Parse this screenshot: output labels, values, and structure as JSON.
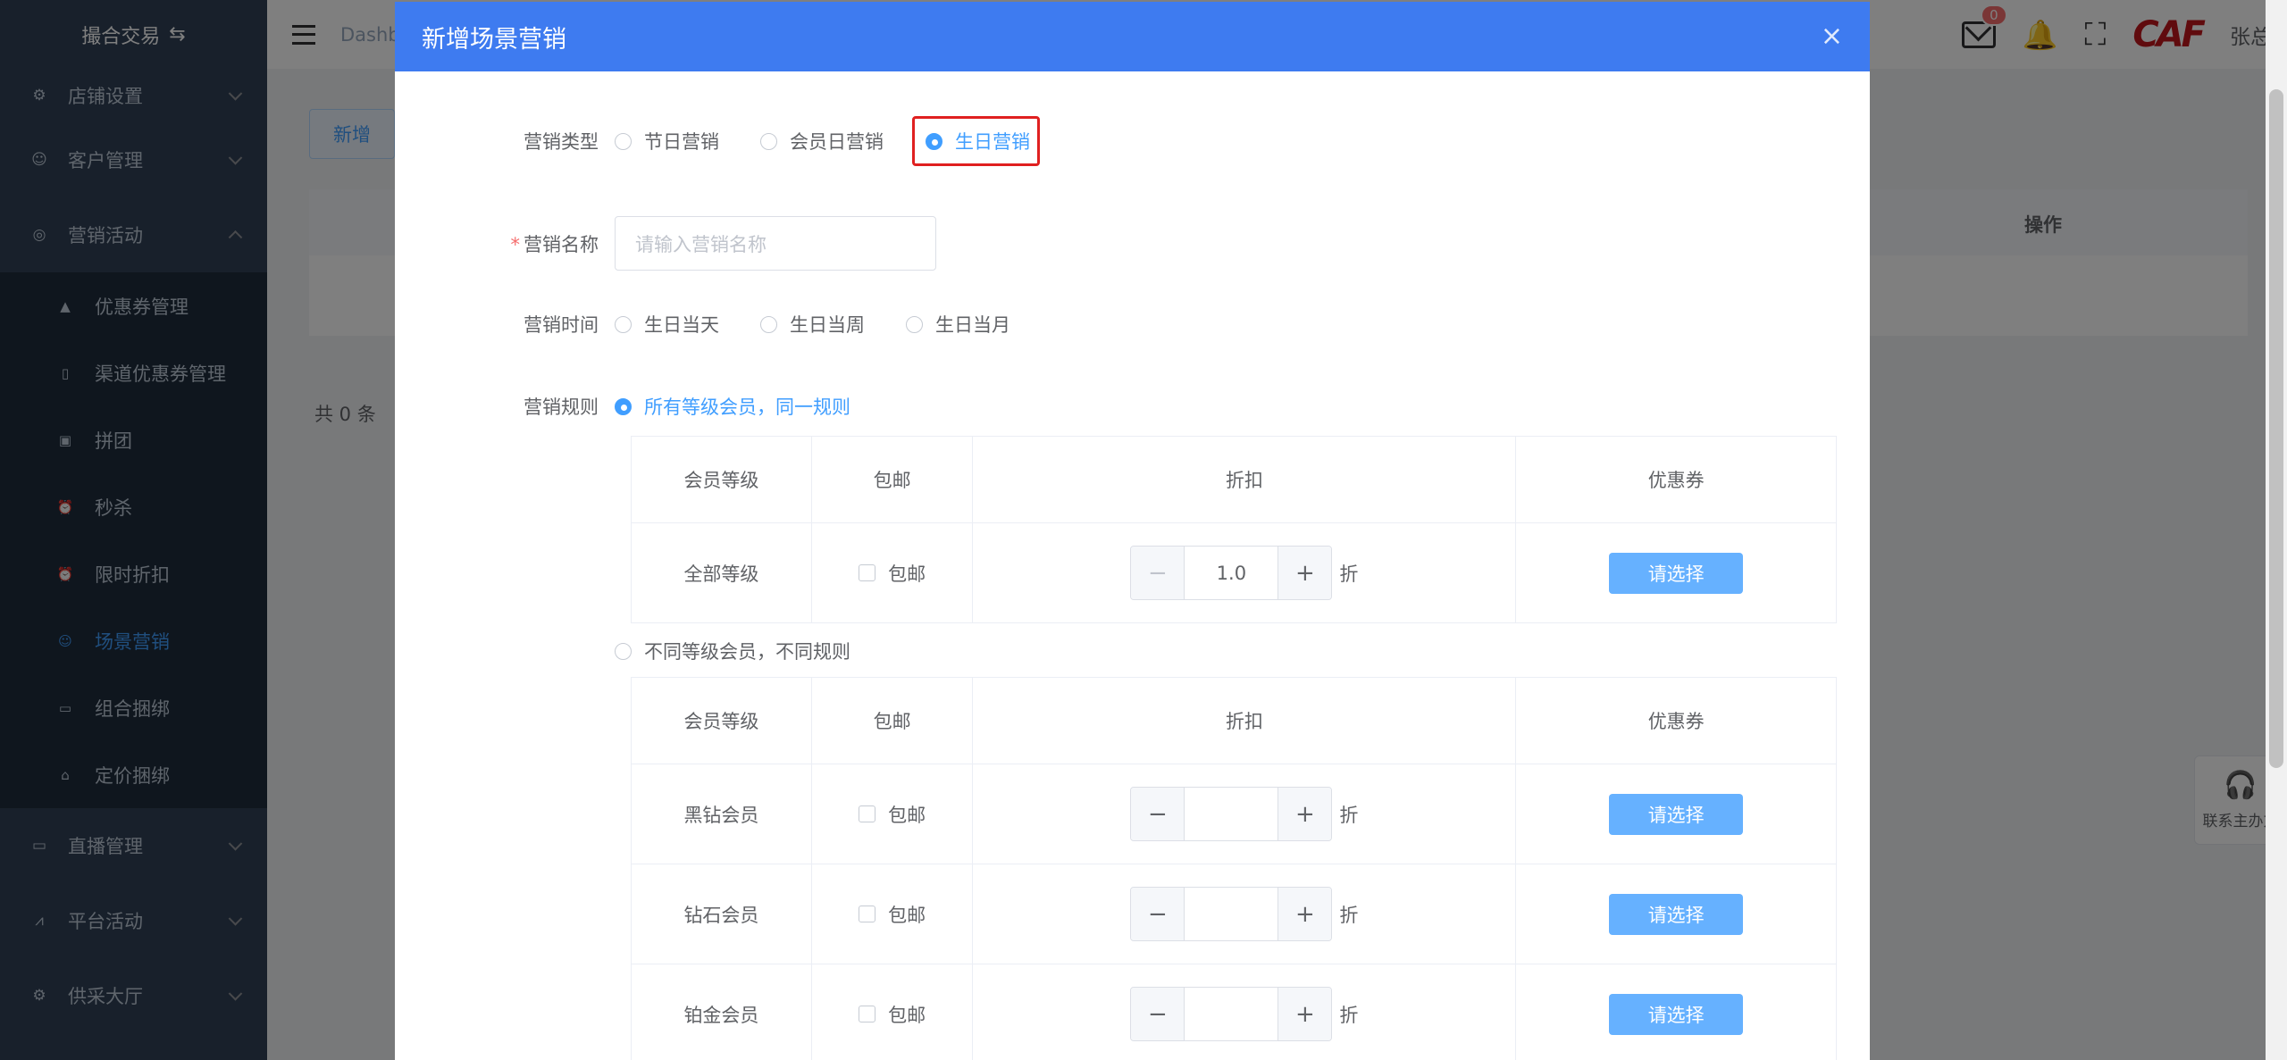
{
  "sidebar": {
    "brand": "撮合交易",
    "menu_top": [
      {
        "label": "店铺设置",
        "icon": "gear-icon"
      },
      {
        "label": "客户管理",
        "icon": "user-icon"
      },
      {
        "label": "营销活动",
        "icon": "compass-icon"
      }
    ],
    "submenu": [
      {
        "label": "优惠券管理",
        "icon": "lock-icon"
      },
      {
        "label": "渠道优惠券管理",
        "icon": "phone-icon"
      },
      {
        "label": "拼团",
        "icon": "briefcase-icon"
      },
      {
        "label": "秒杀",
        "icon": "alarm-icon"
      },
      {
        "label": "限时折扣",
        "icon": "alarm-icon"
      },
      {
        "label": "场景营销",
        "icon": "smile-icon"
      },
      {
        "label": "组合捆绑",
        "icon": "suitcase-icon"
      },
      {
        "label": "定价捆绑",
        "icon": "basket-icon"
      }
    ],
    "menu_bottom": [
      {
        "label": "直播管理",
        "icon": "video-icon"
      },
      {
        "label": "平台活动",
        "icon": "chart-icon"
      },
      {
        "label": "供采大厅",
        "icon": "gear-icon"
      }
    ]
  },
  "navbar": {
    "breadcrumb": "Dashb",
    "badge_count": "0",
    "logo": "CAF",
    "username": "张总"
  },
  "background": {
    "add_button": "新增",
    "table_op_header": "操作",
    "total": "共 0 条",
    "contact": "联系主办方"
  },
  "dialog": {
    "title": "新增场景营销",
    "type": {
      "label": "营销类型",
      "options": [
        "节日营销",
        "会员日营销",
        "生日营销"
      ],
      "selected": "生日营销"
    },
    "name": {
      "label": "营销名称",
      "placeholder": "请输入营销名称",
      "value": ""
    },
    "time": {
      "label": "营销时间",
      "options": [
        "生日当天",
        "生日当周",
        "生日当月"
      ]
    },
    "rule": {
      "label": "营销规则",
      "option_same": "所有等级会员，同一规则",
      "option_diff": "不同等级会员，不同规则"
    },
    "columns": [
      "会员等级",
      "包邮",
      "折扣",
      "优惠券"
    ],
    "free_shipping_label": "包邮",
    "discount_unit": "折",
    "choose_label": "请选择",
    "same_rule_rows": [
      {
        "level": "全部等级",
        "discount": "1.0"
      }
    ],
    "diff_rule_rows": [
      {
        "level": "黑钻会员",
        "discount": ""
      },
      {
        "level": "钻石会员",
        "discount": ""
      },
      {
        "level": "铂金会员",
        "discount": ""
      }
    ]
  }
}
